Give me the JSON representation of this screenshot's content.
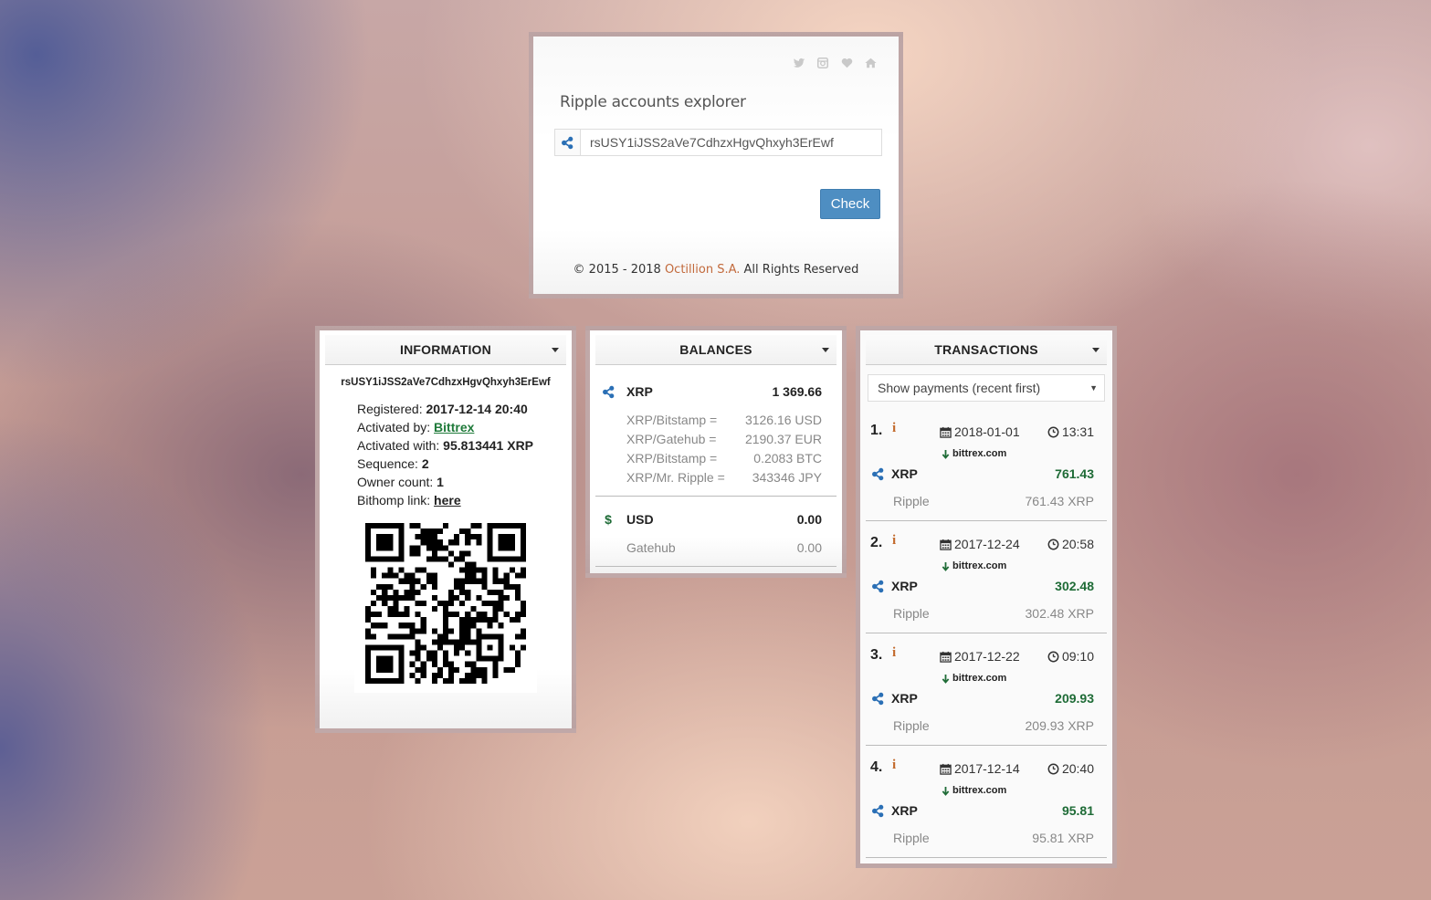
{
  "header": {
    "title": "Ripple accounts explorer",
    "address_value": "rsUSY1iJSS2aVe7CdhzxHgvQhxyh3ErEwf",
    "check_label": "Check",
    "social_icons": [
      "twitter-icon",
      "instagram-icon",
      "heart-icon",
      "home-icon"
    ],
    "copyright_prefix": "© 2015 - 2018",
    "copyright_link": "Octillion S.A.",
    "copyright_suffix": "All Rights Reserved"
  },
  "colors": {
    "accent_button": "#4e8ec2",
    "positive_amount": "#1e6b36",
    "link_green": "#1f7a3a",
    "info_orange": "#c26a2c",
    "ripple_blue": "#2a6fb5"
  },
  "information": {
    "title": "INFORMATION",
    "address": "rsUSY1iJSS2aVe7CdhzxHgvQhxyh3ErEwf",
    "registered_label": "Registered:",
    "registered_value": "2017-12-14 20:40",
    "activated_by_label": "Activated by:",
    "activated_by_value": "Bittrex",
    "activated_with_label": "Activated with:",
    "activated_with_value": "95.813441 XRP",
    "sequence_label": "Sequence:",
    "sequence_value": "2",
    "owner_count_label": "Owner count:",
    "owner_count_value": "1",
    "bithomp_label": "Bithomp link:",
    "bithomp_value": "here"
  },
  "balances": {
    "title": "BALANCES",
    "xrp": {
      "currency": "XRP",
      "amount": "1 369.66",
      "rates": [
        {
          "label": "XRP/Bitstamp =",
          "value": "3126.16 USD"
        },
        {
          "label": "XRP/Gatehub =",
          "value": "2190.37 EUR"
        },
        {
          "label": "XRP/Bitstamp =",
          "value": "0.2083 BTC"
        },
        {
          "label": "XRP/Mr. Ripple =",
          "value": "343346 JPY"
        }
      ]
    },
    "usd": {
      "symbol": "$",
      "currency": "USD",
      "amount": "0.00",
      "issuer": "Gatehub",
      "issuer_amount": "0.00"
    }
  },
  "transactions": {
    "title": "TRANSACTIONS",
    "filter": "Show payments (recent first)",
    "items": [
      {
        "num": "1.",
        "info": "i",
        "date": "2018-01-01",
        "time": "13:31",
        "source": "bittrex.com",
        "currency": "XRP",
        "amount": "761.43",
        "issuer": "Ripple",
        "issuer_amount": "761.43 XRP"
      },
      {
        "num": "2.",
        "info": "i",
        "date": "2017-12-24",
        "time": "20:58",
        "source": "bittrex.com",
        "currency": "XRP",
        "amount": "302.48",
        "issuer": "Ripple",
        "issuer_amount": "302.48 XRP"
      },
      {
        "num": "3.",
        "info": "i",
        "date": "2017-12-22",
        "time": "09:10",
        "source": "bittrex.com",
        "currency": "XRP",
        "amount": "209.93",
        "issuer": "Ripple",
        "issuer_amount": "209.93 XRP"
      },
      {
        "num": "4.",
        "info": "i",
        "date": "2017-12-14",
        "time": "20:40",
        "source": "bittrex.com",
        "currency": "XRP",
        "amount": "95.81",
        "issuer": "Ripple",
        "issuer_amount": "95.81 XRP"
      }
    ]
  }
}
